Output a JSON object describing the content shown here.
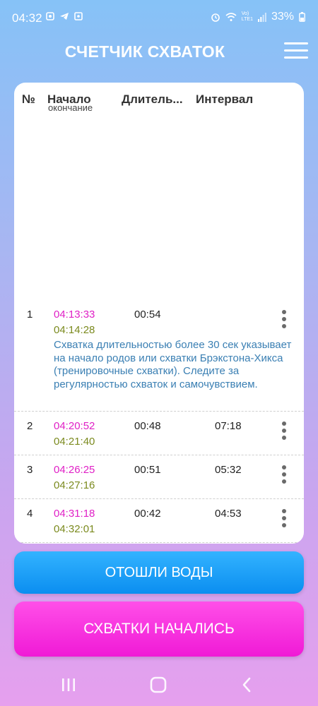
{
  "status_bar": {
    "time": "04:32",
    "battery": "33%",
    "network_label_top": "Vo)",
    "network_label_bottom": "LTE1"
  },
  "header": {
    "title": "СЧЕТЧИК СХВАТОК",
    "menu_icon": "hamburger-menu-icon"
  },
  "table": {
    "columns": {
      "number": "№",
      "start": "Начало",
      "start_sub": "окончание",
      "duration": "Длитель...",
      "interval": "Интервал"
    },
    "rows": [
      {
        "num": "1",
        "start": "04:13:33",
        "end": "04:14:28",
        "duration": "00:54",
        "interval": "",
        "note": "Схватка длительностью более 30 сек указывает на начало родов или схватки Брэкстона-Хикса (тренировочные схватки). Следите за регулярностью схваток и самочувствием."
      },
      {
        "num": "2",
        "start": "04:20:52",
        "end": "04:21:40",
        "duration": "00:48",
        "interval": "07:18"
      },
      {
        "num": "3",
        "start": "04:26:25",
        "end": "04:27:16",
        "duration": "00:51",
        "interval": "05:32"
      },
      {
        "num": "4",
        "start": "04:31:18",
        "end": "04:32:01",
        "duration": "00:42",
        "interval": "04:53"
      }
    ]
  },
  "buttons": {
    "water": "ОТОШЛИ ВОДЫ",
    "start": "СХВАТКИ НАЧАЛИСЬ"
  },
  "colors": {
    "start_time": "#e020c6",
    "end_time": "#7b8a1e",
    "note": "#3a7fb3",
    "water_button": "#1a9ff5",
    "start_button": "#f52ddc"
  }
}
